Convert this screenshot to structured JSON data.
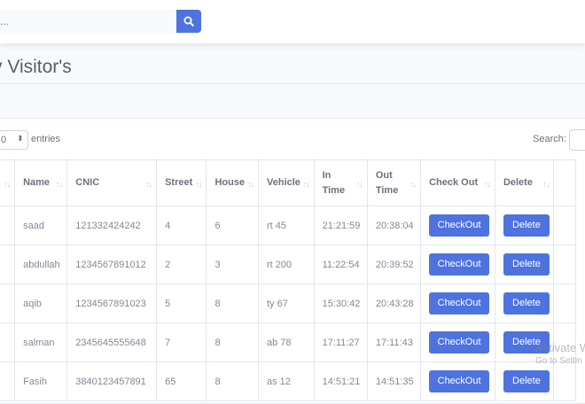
{
  "topbar": {
    "search_placeholder": "..."
  },
  "page": {
    "title": "y Visitor's"
  },
  "controls": {
    "length_value": "0",
    "entries_label": "entries",
    "search_label": "Search:"
  },
  "table": {
    "headers": {
      "name": "Name",
      "cnic": "CNIC",
      "street": "Street",
      "house": "House",
      "vehicle": "Vehicle",
      "in_time_1": "In",
      "in_time_2": "Time",
      "out_time_1": "Out",
      "out_time_2": "Time",
      "check_out": "Check Out",
      "delete": "Delete"
    },
    "rows": [
      {
        "name": "saad",
        "cnic": "121332424242",
        "street": "4",
        "house": "6",
        "vehicle": "rt 45",
        "in_time": "21:21:59",
        "out_time": "20:38:04",
        "checkout_label": "CheckOut",
        "delete_label": "Delete"
      },
      {
        "name": "abdullah",
        "cnic": "1234567891012",
        "street": "2",
        "house": "3",
        "vehicle": "rt 200",
        "in_time": "11:22:54",
        "out_time": "20:39:52",
        "checkout_label": "CheckOut",
        "delete_label": "Delete"
      },
      {
        "name": "aqib",
        "cnic": "1234567891023",
        "street": "5",
        "house": "8",
        "vehicle": "ty 67",
        "in_time": "15:30:42",
        "out_time": "20:43:28",
        "checkout_label": "CheckOut",
        "delete_label": "Delete"
      },
      {
        "name": "salman",
        "cnic": "2345645555648",
        "street": "7",
        "house": "8",
        "vehicle": "ab 78",
        "in_time": "17:11:27",
        "out_time": "17:11:43",
        "checkout_label": "CheckOut",
        "delete_label": "Delete"
      },
      {
        "name": "Fasih",
        "cnic": "3840123457891",
        "street": "65",
        "house": "8",
        "vehicle": "as 12",
        "in_time": "14:51:21",
        "out_time": "14:51:35",
        "checkout_label": "CheckOut",
        "delete_label": "Delete"
      }
    ]
  },
  "watermark": {
    "line1": "Activate W",
    "line2": "Go to Settin"
  },
  "colors": {
    "primary": "#4e73df",
    "text": "#858796",
    "heading": "#5a5c69",
    "border": "#e3e6f0",
    "background": "#f8f9fc"
  },
  "icons": {
    "search": "search-icon",
    "sort": "sort-icon",
    "select_caret": "caret-icon"
  }
}
